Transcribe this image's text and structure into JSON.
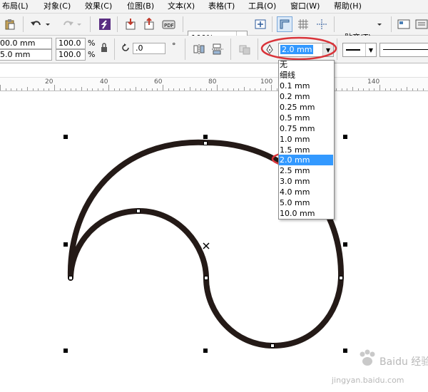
{
  "menubar": {
    "items": [
      "布局(L)",
      "对象(C)",
      "效果(C)",
      "位图(B)",
      "文本(X)",
      "表格(T)",
      "工具(O)",
      "窗口(W)",
      "帮助(H)"
    ]
  },
  "toolbar": {
    "zoom_value": "100%",
    "snap_label": "贴齐(T)"
  },
  "propbar": {
    "x_value": "00.0 mm",
    "y_value": "5.0 mm",
    "scale_x": "100.0",
    "scale_y": "100.0",
    "percent_x": "%",
    "percent_y": "%",
    "rotation": ".0",
    "degree": "°",
    "outline_width": "2.0 mm"
  },
  "ruler": {
    "labels": [
      "20",
      "40",
      "60",
      "80",
      "100",
      "120",
      "140"
    ]
  },
  "outline_dropdown": {
    "options": [
      "无",
      "细线",
      "0.1 mm",
      "0.2 mm",
      "0.25 mm",
      "0.5 mm",
      "0.75 mm",
      "1.0 mm",
      "1.5 mm",
      "2.0 mm",
      "2.5 mm",
      "3.0 mm",
      "4.0 mm",
      "5.0 mm",
      "10.0 mm"
    ],
    "selected": "2.0 mm"
  },
  "colors": {
    "curve": "#241a17",
    "highlight_ellipse": "#d9343a",
    "selected_bg": "#3399ff"
  },
  "watermark": {
    "brand": "Baidu 经验",
    "url": "jingyan.baidu.com"
  }
}
